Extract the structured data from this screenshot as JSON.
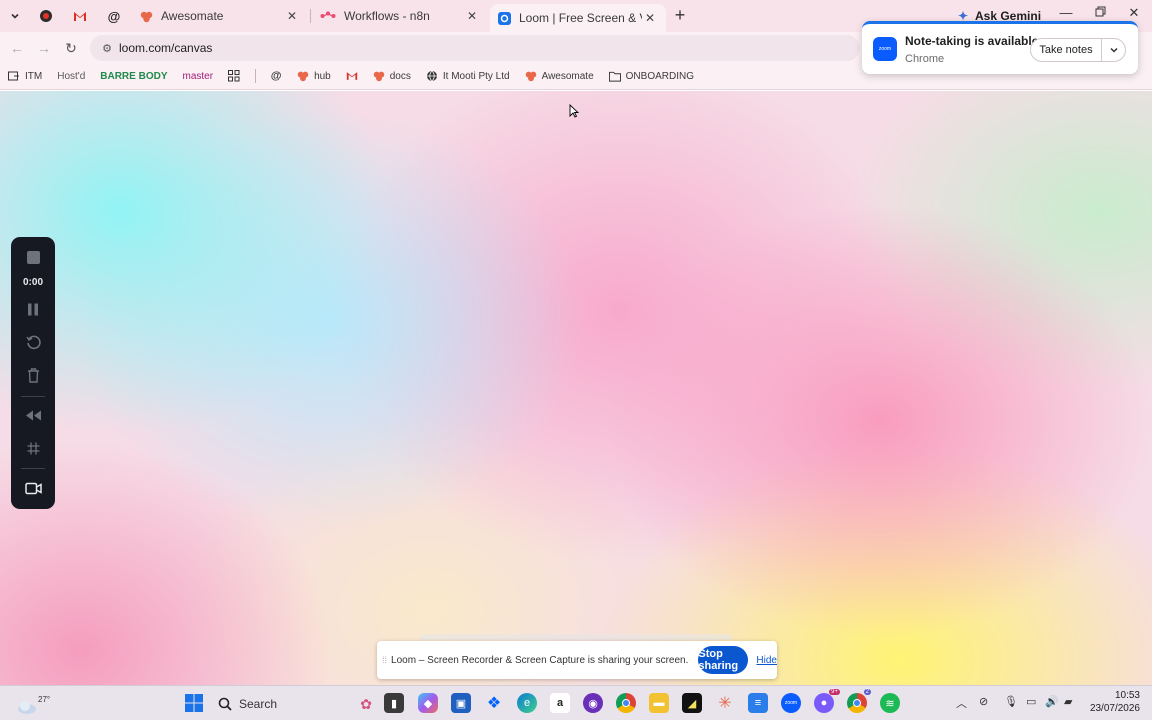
{
  "browser": {
    "tabs": [
      {
        "title": "Awesomate",
        "icon": "loom-flower-icon"
      },
      {
        "title": "Workflows - n8n",
        "icon": "n8n-icon"
      },
      {
        "title": "Loom | Free Screen & Video Re",
        "icon": "loom-icon",
        "active": true
      }
    ],
    "gemini_label": "Ask Gemini",
    "url": "loom.com/canvas"
  },
  "bookmarks": [
    {
      "label": "ITM"
    },
    {
      "label": "Host'd"
    },
    {
      "label": "BARRE BODY"
    },
    {
      "label": "master"
    },
    {
      "label": "hub"
    },
    {
      "label": "docs"
    },
    {
      "label": "It Mooti Pty Ltd"
    },
    {
      "label": "Awesomate"
    },
    {
      "label": "ONBOARDING"
    }
  ],
  "loom_controls": {
    "timer": "0:00"
  },
  "popup": {
    "title": "Note-taking is available",
    "subtitle": "Chrome",
    "button": "Take notes",
    "logo_text": "zoom"
  },
  "sharing_banner": {
    "text": "Loom – Screen Recorder & Screen Capture is sharing your screen.",
    "stop_label": "Stop sharing",
    "hide_label": "Hide"
  },
  "taskbar": {
    "temperature": "27°",
    "search_label": "Search",
    "time": "10:53",
    "date": "23/07/2026",
    "badges": {
      "messenger": "9+",
      "teams": "2"
    }
  },
  "colors": {
    "accent": "#0b57d0",
    "tabstrip": "#f8e3ea",
    "recorder_bg": "#161922"
  }
}
